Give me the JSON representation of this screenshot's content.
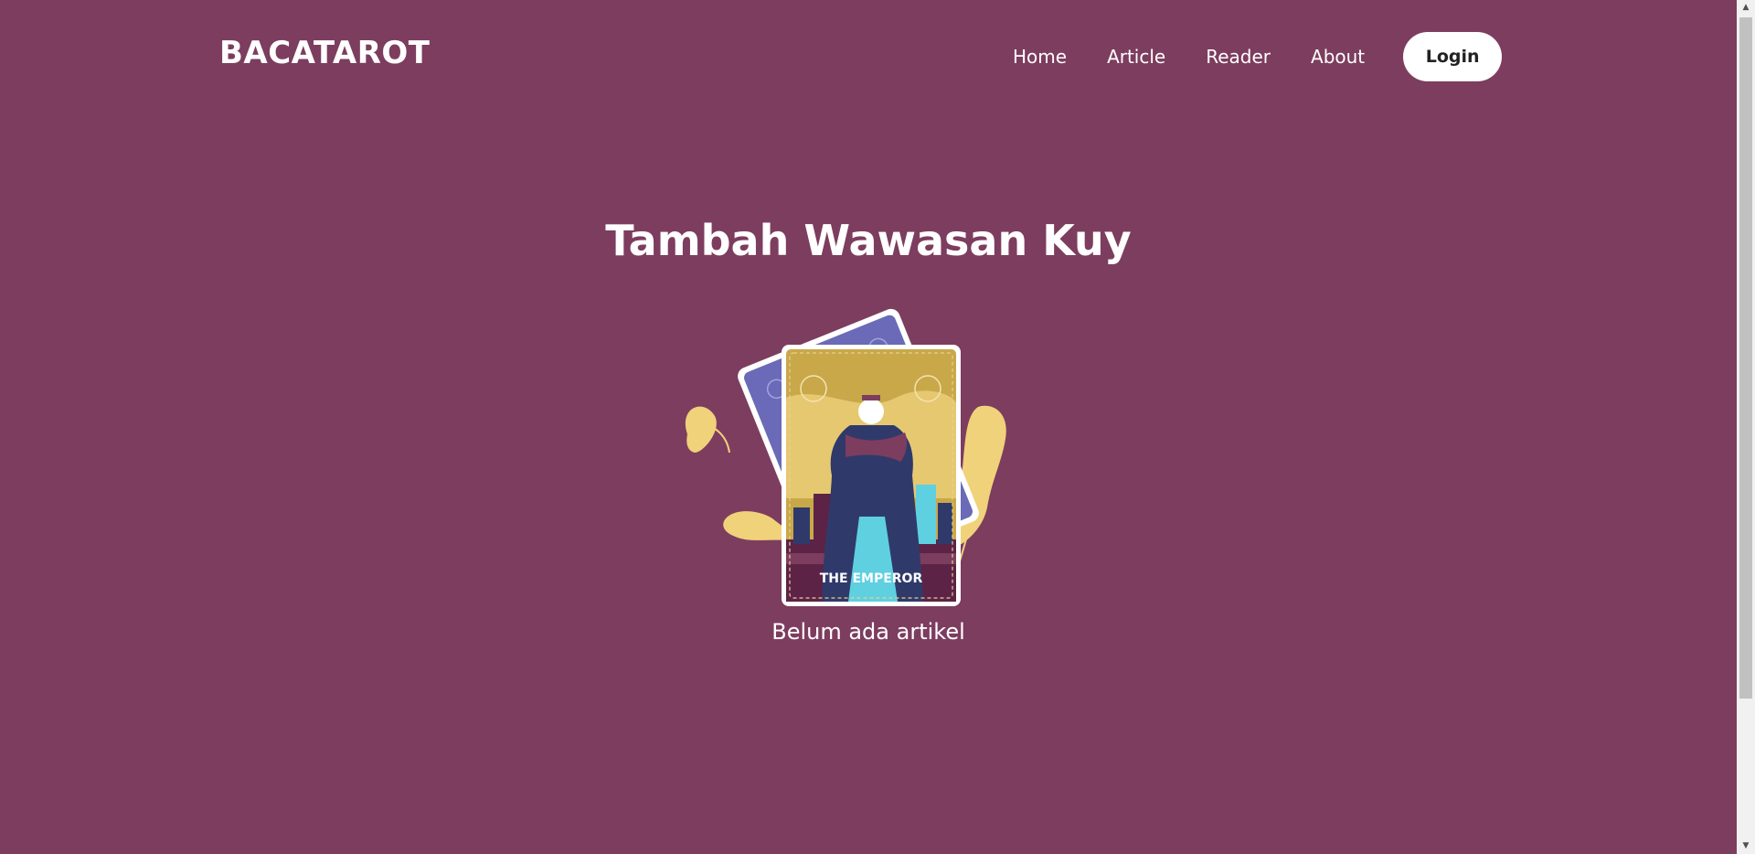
{
  "header": {
    "brand": "BACATAROT",
    "nav": [
      "Home",
      "Article",
      "Reader",
      "About"
    ],
    "login_label": "Login"
  },
  "main": {
    "headline": "Tambah Wawasan Kuy",
    "card_caption": "THE EMPEROR",
    "empty_message": "Belum ada artikel"
  },
  "colors": {
    "background": "#7d3d5f",
    "card_back": "#6a6ab8",
    "card_front": "#c9a84a",
    "leaf": "#f0d27a",
    "robe": "#2f3a6b",
    "accent_cyan": "#5fd0e0"
  },
  "icons": {
    "scroll_up": "scroll-up-arrow-icon",
    "scroll_down": "scroll-down-arrow-icon"
  }
}
